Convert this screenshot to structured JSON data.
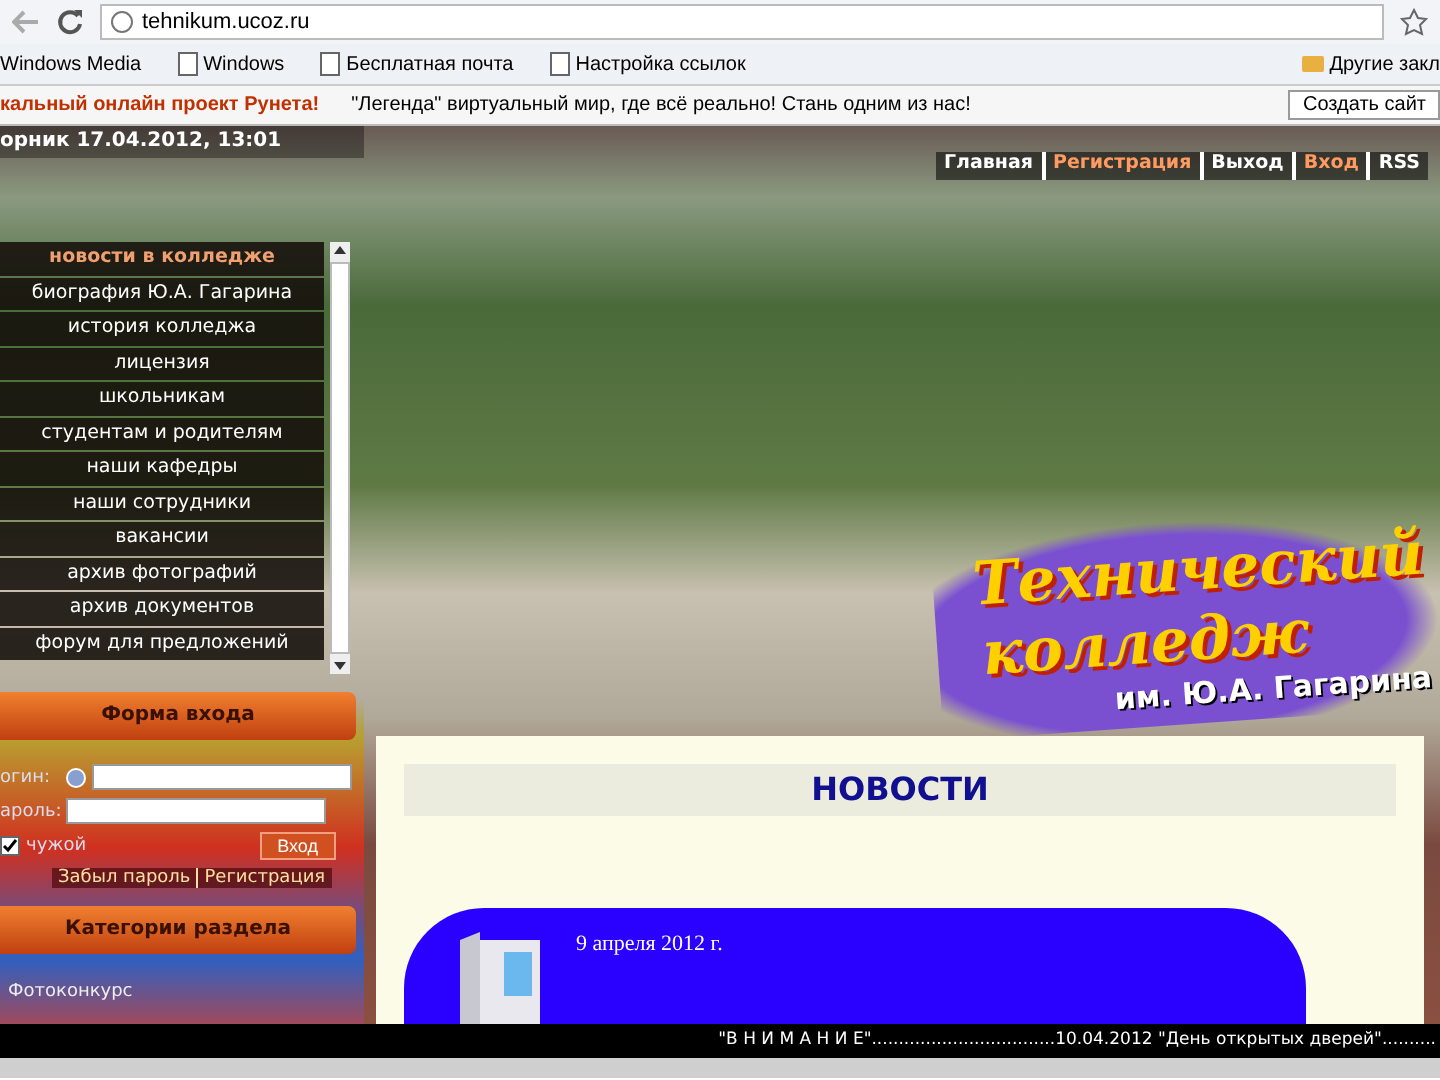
{
  "browser": {
    "url": "tehnikum.ucoz.ru",
    "bookmarks": [
      {
        "label": "Windows Media",
        "kind": "plain"
      },
      {
        "label": "Windows",
        "kind": "page"
      },
      {
        "label": "Бесплатная почта",
        "kind": "page"
      },
      {
        "label": "Настройка ссылок",
        "kind": "page"
      }
    ],
    "other_bookmarks": "Другие закл"
  },
  "ucoz_bar": {
    "promo": "кальный онлайн проект Рунета!",
    "message": "\"Легенда\" виртуальный мир, где всё реально! Стань одним из нас!",
    "create_button": "Создать сайт"
  },
  "date": "орник 17.04.2012, 13:01",
  "top_nav": [
    {
      "label": "Главная",
      "selected": false
    },
    {
      "label": "Регистрация",
      "selected": true
    },
    {
      "label": "Выход",
      "selected": false
    },
    {
      "label": "Вход",
      "selected": true
    },
    {
      "label": "RSS",
      "selected": false
    }
  ],
  "menu": [
    {
      "label": "новости в колледже",
      "selected": true
    },
    {
      "label": "биография Ю.А. Гагарина",
      "selected": false
    },
    {
      "label": "история колледжа",
      "selected": false
    },
    {
      "label": "лицензия",
      "selected": false
    },
    {
      "label": "школьникам",
      "selected": false
    },
    {
      "label": "студентам и родителям",
      "selected": false
    },
    {
      "label": "наши кафедры",
      "selected": false
    },
    {
      "label": "наши сотрудники",
      "selected": false
    },
    {
      "label": "вакансии",
      "selected": false
    },
    {
      "label": "архив фотографий",
      "selected": false
    },
    {
      "label": "архив документов",
      "selected": false
    },
    {
      "label": "форум для предложений",
      "selected": false
    }
  ],
  "login": {
    "title": "Форма входа",
    "login_label": "огин:",
    "password_label": "ароль:",
    "remember": {
      "label": "чужой",
      "checked": true
    },
    "submit": "Вход",
    "links": [
      "Забыл пароль",
      "Регистрация"
    ]
  },
  "categories": {
    "title": "Категории раздела",
    "items": [
      "Фотоконкурс"
    ]
  },
  "logo": {
    "line1": "Технический",
    "line2": "колледж",
    "line3": "им. Ю.А. Гагарина"
  },
  "content": {
    "title": "НОВОСТИ",
    "news": [
      {
        "date": "9 апреля 2012 г."
      }
    ]
  },
  "ticker": "\"В Н И М А Н И Е\"..................................10.04.2012 \"День открытых дверей\".........."
}
